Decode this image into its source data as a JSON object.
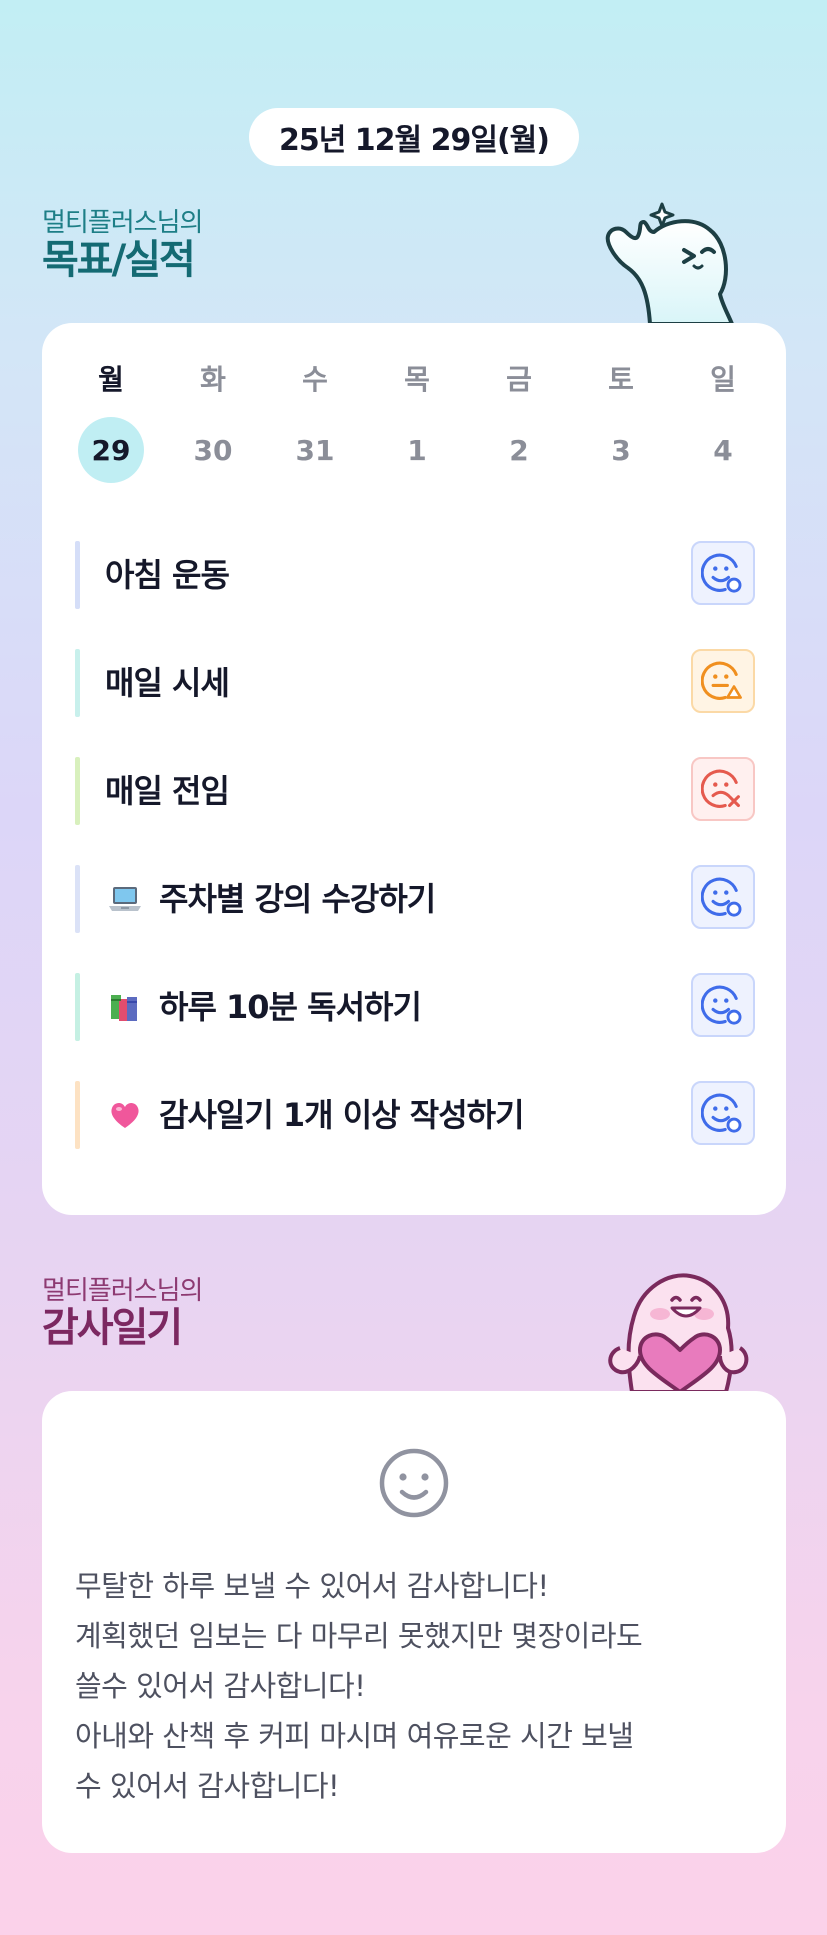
{
  "date_label": "25년 12월 29일(월)",
  "goals_section": {
    "subtitle": "멀티플러스님의",
    "title": "목표/실적"
  },
  "week": [
    {
      "day": "월",
      "num": "29",
      "active": true
    },
    {
      "day": "화",
      "num": "30"
    },
    {
      "day": "수",
      "num": "31"
    },
    {
      "day": "목",
      "num": "1"
    },
    {
      "day": "금",
      "num": "2"
    },
    {
      "day": "토",
      "num": "3"
    },
    {
      "day": "일",
      "num": "4"
    }
  ],
  "goals": [
    {
      "text": "아침 운동",
      "status": "done",
      "bar_color": "#d5def8"
    },
    {
      "text": "매일 시세",
      "status": "partial",
      "bar_color": "#c8f0ec"
    },
    {
      "text": "매일 전임",
      "status": "failed",
      "bar_color": "#d8f0bd"
    },
    {
      "text": "주차별 강의 수강하기",
      "icon": "laptop-icon",
      "status": "done",
      "bar_color": "#dbe2f7"
    },
    {
      "text": "하루 10분 독서하기",
      "icon": "books-icon",
      "status": "done",
      "bar_color": "#c5f0e3"
    },
    {
      "text": "감사일기 1개 이상 작성하기",
      "icon": "heart-icon",
      "status": "done",
      "bar_color": "#fde2c3"
    }
  ],
  "status_colors": {
    "done": "#3f6cea",
    "partial": "#f08f1f",
    "failed": "#e55a4e"
  },
  "gratitude_section": {
    "subtitle": "멀티플러스님의",
    "title": "감사일기"
  },
  "diary": {
    "mood_icon": "smiley-icon",
    "lines": [
      "무탈한 하루 보낼 수 있어서 감사합니다!",
      "계획했던 임보는 다 마무리 못했지만 몇장이라도",
      "쓸수 있어서 감사합니다!",
      "아내와 산책 후 커피 마시며 여유로운 시간 보낼",
      "수 있어서 감사합니다!"
    ]
  }
}
